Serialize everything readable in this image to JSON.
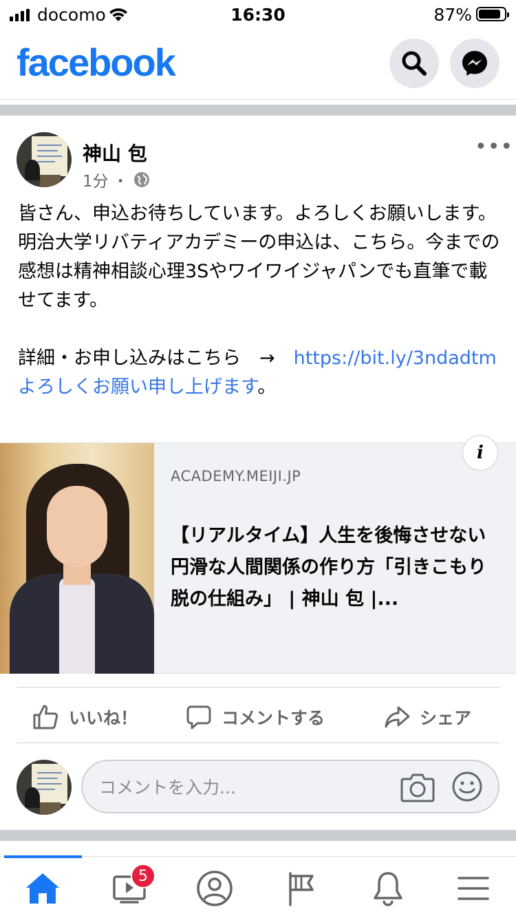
{
  "status_bar": {
    "carrier": "docomo",
    "time": "16:30",
    "battery": "87%",
    "battery_level": 0.87
  },
  "header": {
    "logo": "facebook",
    "brand_color": "#1877f2",
    "icons": [
      "search-icon",
      "messenger-icon"
    ]
  },
  "post": {
    "author": "神山 包",
    "time": "1分",
    "separator": "・",
    "audience_icon": "globe-icon",
    "text_main": "皆さん、申込お待ちしています。よろしくお願いします。\n明治大学リバティアカデミーの申込は、こちら。今までの感想は精神相談心理3Sやワイワイジャパンでも直筆で載せてます。\n\n詳細・お申し込みはこちら　→　",
    "link_text": "https://bit.ly/3ndadtmよろしくお願い申し上げます",
    "text_end": "。",
    "link_color": "#3577e6"
  },
  "preview": {
    "domain": "ACADEMY.MEIJI.JP",
    "title": "【リアルタイム】人生を後悔させない円滑な人間関係の作り方「引きこもり脱の仕組み」 | 神山 包 |...",
    "info_label": "i"
  },
  "actions": {
    "like": "いいね！",
    "comment": "コメントする",
    "share": "シェア"
  },
  "comment": {
    "placeholder": "コメントを入力..."
  },
  "nav": {
    "items": [
      "home-icon",
      "watch-icon",
      "profile-icon",
      "pages-icon",
      "notifications-icon",
      "menu-icon"
    ],
    "watch_badge": "5"
  }
}
